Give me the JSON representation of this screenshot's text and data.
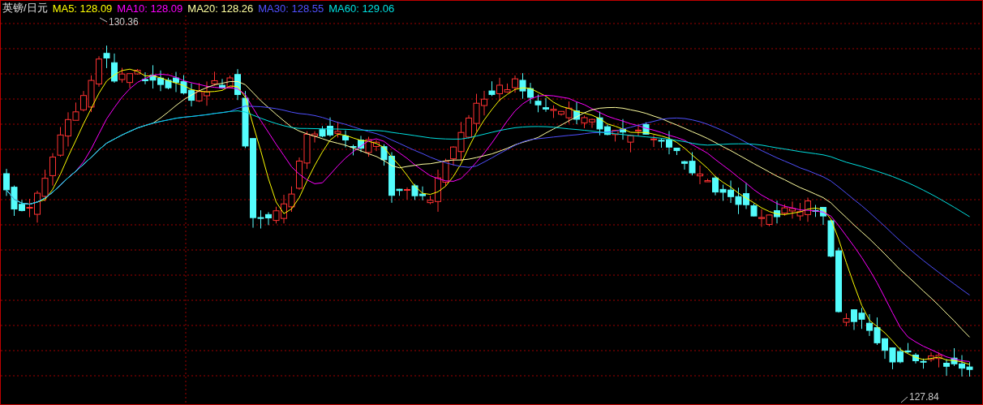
{
  "header": {
    "symbol": "英镑/日元",
    "indicators": [
      {
        "label": "MA5: 128.09",
        "color": "#ffff00"
      },
      {
        "label": "MA10: 128.09",
        "color": "#ff00ff"
      },
      {
        "label": "MA20: 128.26",
        "color": "#ffffa0"
      },
      {
        "label": "MA30: 128.55",
        "color": "#5050ff"
      },
      {
        "label": "MA60: 129.06",
        "color": "#00e0e0"
      }
    ]
  },
  "chart": {
    "high_label": "130.36",
    "low_label": "127.84"
  }
}
